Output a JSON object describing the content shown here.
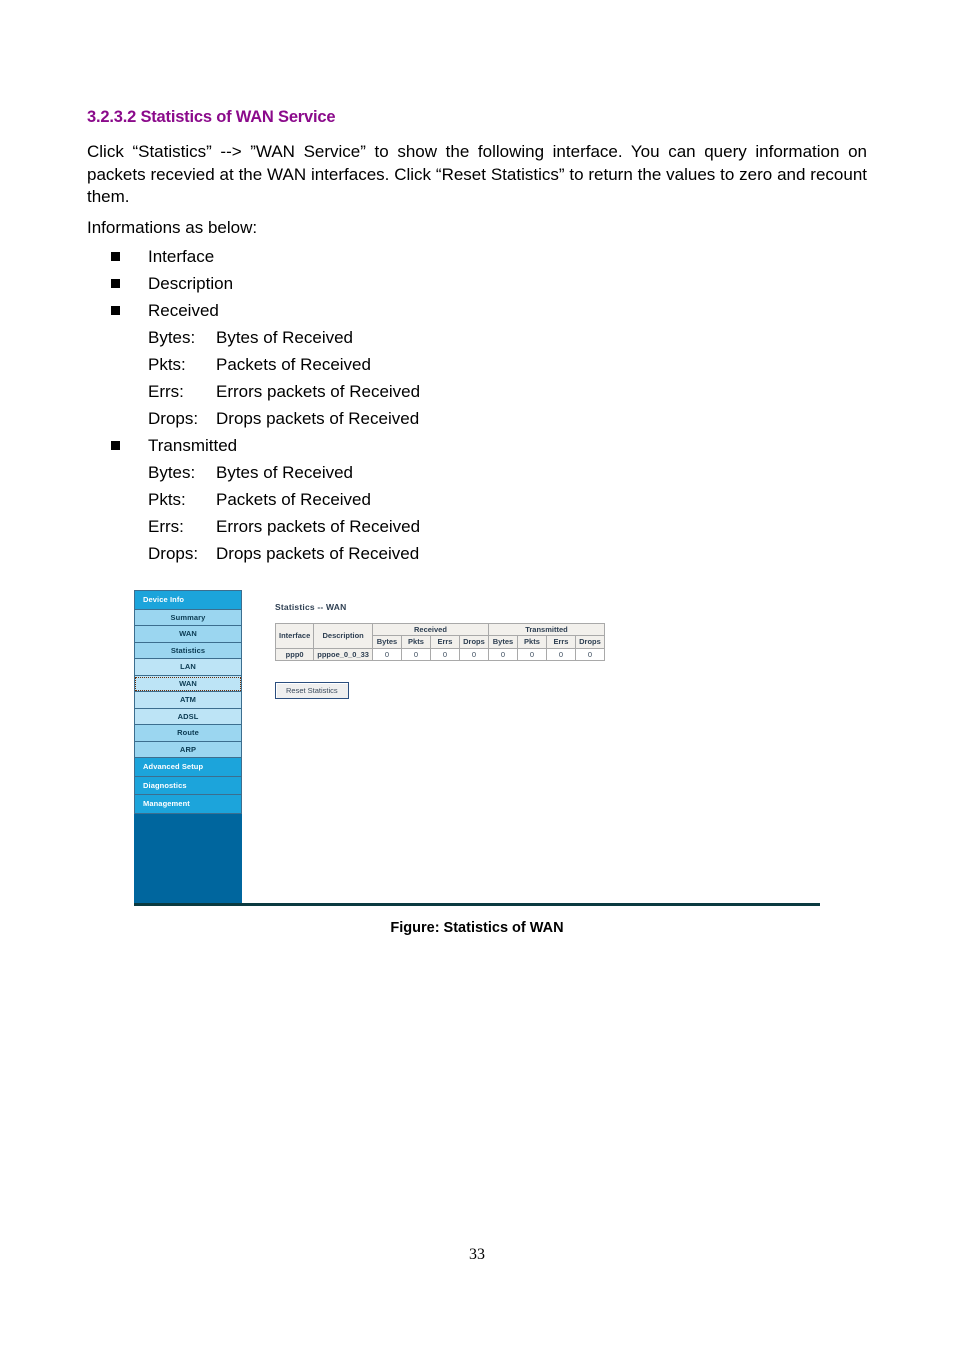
{
  "document": {
    "heading": "3.2.3.2 Statistics of WAN Service",
    "paragraph": "Click “Statistics”  -->  ”WAN  Service” to show  the  following  interface.  You  can  query information on packets recevied at the WAN interfaces. Click “Reset Statistics” to return the values to zero and recount them.",
    "intro_line": "Informations as below:",
    "page_number": "33"
  },
  "info_list": [
    {
      "label": "Interface",
      "subitems": []
    },
    {
      "label": "Description",
      "subitems": []
    },
    {
      "label": "Received",
      "subitems": [
        {
          "key": "Bytes:",
          "value": "Bytes of Received"
        },
        {
          "key": "Pkts:",
          "value": "Packets of Received"
        },
        {
          "key": "Errs:",
          "value": "Errors packets of Received"
        },
        {
          "key": "Drops:",
          "value": "Drops packets of Received"
        }
      ]
    },
    {
      "label": "Transmitted",
      "subitems": [
        {
          "key": "Bytes:",
          "value": "Bytes of Received"
        },
        {
          "key": "Pkts:",
          "value": "Packets of Received"
        },
        {
          "key": "Errs:",
          "value": "Errors packets of Received"
        },
        {
          "key": "Drops:",
          "value": "Drops packets of Received"
        }
      ]
    }
  ],
  "figure": {
    "caption": "Figure: Statistics of WAN",
    "screenshot": {
      "sidebar": {
        "items": [
          {
            "label": "Device Info",
            "level": "top",
            "selected": false
          },
          {
            "label": "Summary",
            "level": "sub1",
            "selected": false
          },
          {
            "label": "WAN",
            "level": "sub1",
            "selected": false
          },
          {
            "label": "Statistics",
            "level": "sub1",
            "selected": false
          },
          {
            "label": "LAN",
            "level": "sub2",
            "selected": false
          },
          {
            "label": "WAN",
            "level": "sub2",
            "selected": true
          },
          {
            "label": "ATM",
            "level": "sub2",
            "selected": false
          },
          {
            "label": "ADSL",
            "level": "sub2",
            "selected": false
          },
          {
            "label": "Route",
            "level": "sub1",
            "selected": false
          },
          {
            "label": "ARP",
            "level": "sub1",
            "selected": false
          },
          {
            "label": "Advanced Setup",
            "level": "top",
            "selected": false
          },
          {
            "label": "Diagnostics",
            "level": "top",
            "selected": false
          },
          {
            "label": "Management",
            "level": "top",
            "selected": false
          }
        ]
      },
      "panel": {
        "title": "Statistics -- WAN",
        "table": {
          "group_headers": [
            {
              "label": "Interface",
              "span": 1
            },
            {
              "label": "Description",
              "span": 1
            },
            {
              "label": "Received",
              "span": 4
            },
            {
              "label": "Transmitted",
              "span": 4
            }
          ],
          "sub_headers": [
            "",
            "",
            "Bytes",
            "Pkts",
            "Errs",
            "Drops",
            "Bytes",
            "Pkts",
            "Errs",
            "Drops"
          ],
          "rows": [
            {
              "interface": "ppp0",
              "description": "pppoe_0_0_33",
              "received": {
                "bytes": "0",
                "pkts": "0",
                "errs": "0",
                "drops": "0"
              },
              "transmitted": {
                "bytes": "0",
                "pkts": "0",
                "errs": "0",
                "drops": "0"
              }
            }
          ]
        },
        "reset_button": "Reset Statistics"
      }
    }
  },
  "colors": {
    "heading": "#8B0A8B",
    "sidebar_dark": "#00669E",
    "sidebar_item": "#1CA4DB",
    "sidebar_sub1": "#9BD6F0",
    "sidebar_sub2": "#BDE4F6",
    "rule": "#0B3A40"
  }
}
